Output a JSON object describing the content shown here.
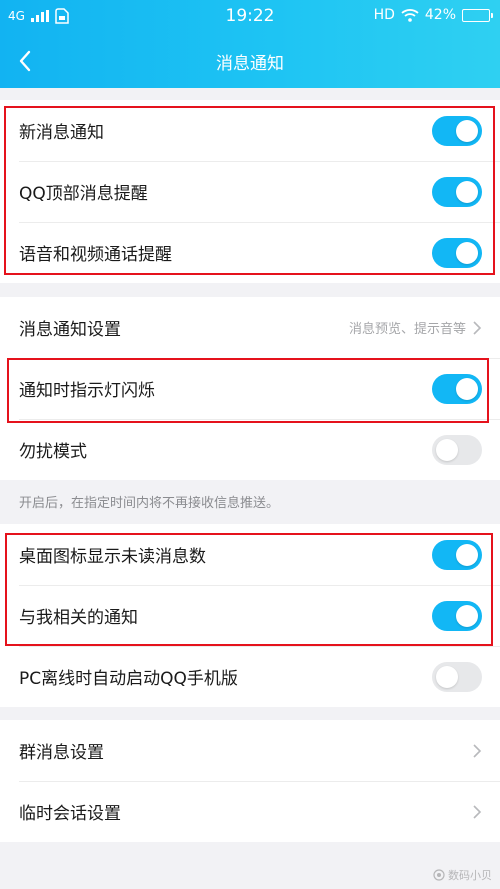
{
  "status_bar": {
    "network": "4G",
    "time": "19:22",
    "hd": "HD",
    "battery": "42%",
    "battery_level": 0.42
  },
  "nav": {
    "title": "消息通知"
  },
  "group1": [
    {
      "label": "新消息通知",
      "on": true
    },
    {
      "label": "QQ顶部消息提醒",
      "on": true
    },
    {
      "label": "语音和视频通话提醒",
      "on": true
    }
  ],
  "group2": {
    "settings_label": "消息通知设置",
    "settings_value": "消息预览、提示音等",
    "led_label": "通知时指示灯闪烁",
    "led_on": true,
    "dnd_label": "勿扰模式",
    "dnd_on": false
  },
  "dnd_note": "开启后，在指定时间内将不再接收信息推送。",
  "group3": [
    {
      "label": "桌面图标显示未读消息数",
      "on": true
    },
    {
      "label": "与我相关的通知",
      "on": true
    },
    {
      "label": "PC离线时自动启动QQ手机版",
      "on": false
    }
  ],
  "group4": [
    {
      "label": "群消息设置"
    },
    {
      "label": "临时会话设置"
    }
  ],
  "watermark": "数码小贝",
  "colors": {
    "accent": "#12b7f5",
    "highlight": "#e5121c"
  }
}
